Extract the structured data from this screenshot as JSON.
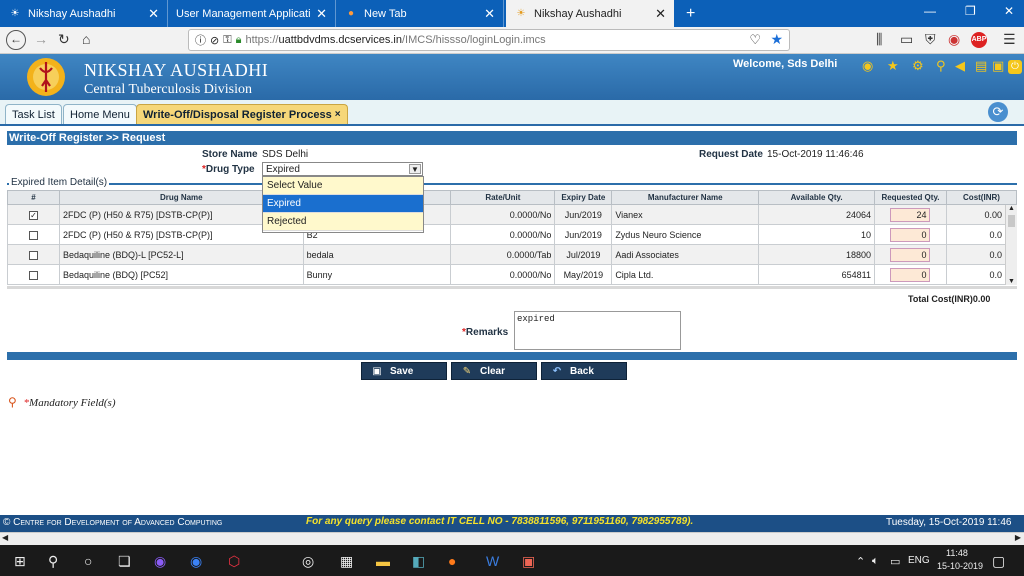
{
  "browser": {
    "tabs": [
      {
        "title": "Nikshay Aushadhi",
        "active": false
      },
      {
        "title": "User Management Application (for",
        "active": false
      },
      {
        "title": "New Tab",
        "active": false
      },
      {
        "title": "Nikshay Aushadhi",
        "active": true
      }
    ],
    "new_tab": "+",
    "url": "https://uattbdvdms.dcservices.in/IMCS/hissso/loginLogin.imcs",
    "url_host": "uattbdvdms.dcservices.in",
    "url_prefix": "https://",
    "url_path": "/IMCS/hissso/loginLogin.imcs"
  },
  "header": {
    "title": "NIKSHAY AUSHADHI",
    "subtitle": "Central Tuberculosis Division",
    "welcome": "Welcome, Sds Delhi"
  },
  "app_tabs": [
    {
      "label": "Task List"
    },
    {
      "label": "Home Menu"
    },
    {
      "label": "Write-Off/Disposal Register Process",
      "close": "×"
    }
  ],
  "form": {
    "breadcrumb": "Write-Off Register >> Request",
    "store_label": "Store Name",
    "store_value": "SDS Delhi",
    "request_date_label": "Request Date",
    "request_date_value": "15-Oct-2019 11:46:46",
    "drug_type_label": "Drug Type",
    "drug_type_value": "Expired",
    "drug_type_options": [
      "Select Value",
      "Expired",
      "Rejected"
    ],
    "fieldset_legend": "Expired Item Detail(s)",
    "columns": [
      "#",
      "Drug Name",
      "",
      "Rate/Unit",
      "Expiry Date",
      "Manufacturer Name",
      "Available Qty.",
      "Requested Qty.",
      "Cost(INR)"
    ],
    "rows": [
      {
        "checked": true,
        "drug": "2FDC (P) (H50 & R75) [DSTB-CP(P)]",
        "batch": "",
        "rate": "0.0000/No",
        "expiry": "Jun/2019",
        "mfr": "Vianex",
        "avail": "24064",
        "req": "24",
        "cost": "0.00"
      },
      {
        "checked": false,
        "drug": "2FDC (P) (H50 & R75) [DSTB-CP(P)]",
        "batch": "B2",
        "rate": "0.0000/No",
        "expiry": "Jun/2019",
        "mfr": "Zydus Neuro Science",
        "avail": "10",
        "req": "0",
        "cost": "0.0"
      },
      {
        "checked": false,
        "drug": "Bedaquiline (BDQ)-L [PC52-L]",
        "batch": "bedala",
        "rate": "0.0000/Tab",
        "expiry": "Jul/2019",
        "mfr": "Aadi Associates",
        "avail": "18800",
        "req": "0",
        "cost": "0.0"
      },
      {
        "checked": false,
        "drug": "Bedaquiline (BDQ) [PC52]",
        "batch": "Bunny",
        "rate": "0.0000/No",
        "expiry": "May/2019",
        "mfr": "Cipla Ltd.",
        "avail": "654811",
        "req": "0",
        "cost": "0.0"
      }
    ],
    "total_label": "Total Cost(INR)",
    "total_value": "0.00",
    "remarks_label": "Remarks",
    "remarks_value": "expired",
    "buttons": {
      "save": "Save",
      "clear": "Clear",
      "back": "Back"
    },
    "mandatory": "Mandatory Field(s)"
  },
  "footer": {
    "org": "Centre for Development of Advanced Computing",
    "contact": "For any query please contact IT CELL NO - 7838811596, 9711951160, 7982955789).",
    "datetime": "Tuesday, 15-Oct-2019 11:46"
  },
  "taskbar": {
    "time": "11:48",
    "date": "15-10-2019",
    "lang": "ENG"
  }
}
